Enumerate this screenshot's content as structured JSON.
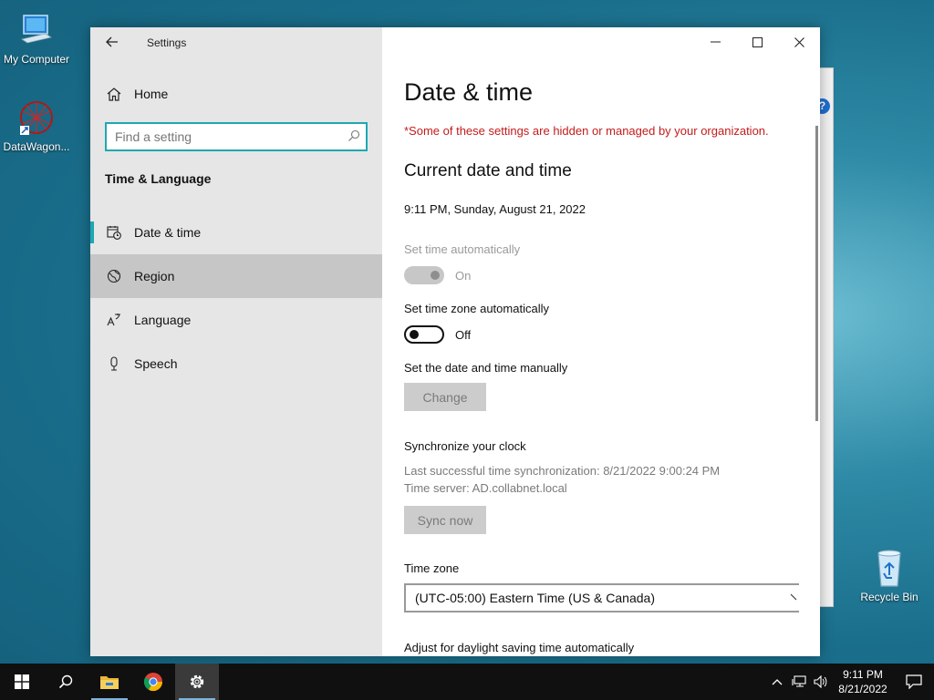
{
  "desktop": {
    "icons": [
      {
        "label": "My Computer",
        "icon": "computer-icon"
      },
      {
        "label": "DataWagon...",
        "icon": "datawagon-icon"
      },
      {
        "label": "Recycle Bin",
        "icon": "recycle-bin-icon"
      }
    ],
    "background_window_badge": "?"
  },
  "window": {
    "title": "Settings",
    "back_icon": "back-arrow-icon",
    "controls": [
      "minimize-icon",
      "maximize-icon",
      "close-icon"
    ]
  },
  "sidebar": {
    "home_label": "Home",
    "search_placeholder": "Find a setting",
    "section_title": "Time & Language",
    "items": [
      {
        "label": "Date & time",
        "icon": "calendar-clock-icon",
        "state": "selected"
      },
      {
        "label": "Region",
        "icon": "globe-icon",
        "state": "hover"
      },
      {
        "label": "Language",
        "icon": "language-icon",
        "state": "normal"
      },
      {
        "label": "Speech",
        "icon": "microphone-icon",
        "state": "normal"
      }
    ]
  },
  "main": {
    "page_title": "Date & time",
    "org_notice": "*Some of these settings are hidden or managed by your organization.",
    "current_section": "Current date and time",
    "current_datetime": "9:11 PM, Sunday, August 21, 2022",
    "set_time_auto": {
      "label": "Set time automatically",
      "state": "On",
      "enabled": false
    },
    "set_timezone_auto": {
      "label": "Set time zone automatically",
      "state": "Off",
      "enabled": true
    },
    "manual": {
      "label": "Set the date and time manually",
      "button": "Change"
    },
    "sync": {
      "title": "Synchronize your clock",
      "last_sync": "Last successful time synchronization: 8/21/2022 9:00:24 PM",
      "server": "Time server: AD.collabnet.local",
      "button": "Sync now"
    },
    "timezone": {
      "label": "Time zone",
      "value": "(UTC-05:00) Eastern Time (US & Canada)"
    },
    "daylight_label": "Adjust for daylight saving time automatically"
  },
  "taskbar": {
    "apps": [
      "windows-start-icon",
      "search-icon",
      "file-explorer-icon",
      "chrome-icon",
      "settings-gear-icon"
    ],
    "clock_time": "9:11 PM",
    "clock_date": "8/21/2022"
  },
  "colors": {
    "accent": "#1fa7b3",
    "warning_text": "#c41b1b",
    "sidebar_bg": "#e6e6e6",
    "hover_bg": "#c6c6c6",
    "taskbar_bg": "#101010"
  }
}
